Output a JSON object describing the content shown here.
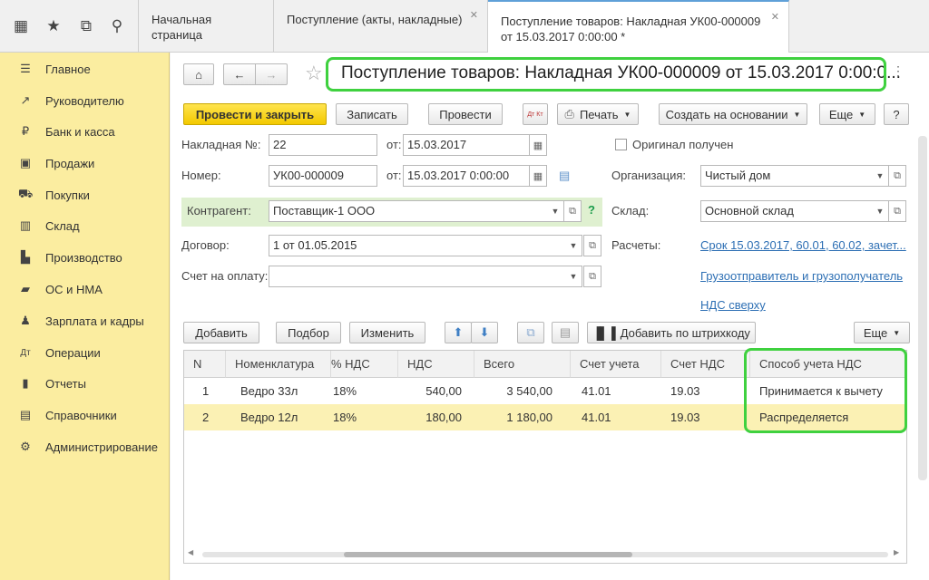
{
  "tabs": [
    {
      "label": "Начальная страница"
    },
    {
      "label": "Поступление (акты, накладные)"
    },
    {
      "label": "Поступление товаров: Накладная УК00-000009 от 15.03.2017 0:00:00 *"
    }
  ],
  "sidebar": {
    "items": [
      {
        "label": "Главное",
        "icon": "menu-icon"
      },
      {
        "label": "Руководителю",
        "icon": "trend-icon"
      },
      {
        "label": "Банк и касса",
        "icon": "ruble-icon"
      },
      {
        "label": "Продажи",
        "icon": "bag-icon"
      },
      {
        "label": "Покупки",
        "icon": "cart-icon"
      },
      {
        "label": "Склад",
        "icon": "warehouse-icon"
      },
      {
        "label": "Производство",
        "icon": "factory-icon"
      },
      {
        "label": "ОС и НМА",
        "icon": "truck-icon"
      },
      {
        "label": "Зарплата и кадры",
        "icon": "people-icon"
      },
      {
        "label": "Операции",
        "icon": "dt-kt-icon"
      },
      {
        "label": "Отчеты",
        "icon": "chart-icon"
      },
      {
        "label": "Справочники",
        "icon": "books-icon"
      },
      {
        "label": "Администрирование",
        "icon": "gear-icon"
      }
    ]
  },
  "doc": {
    "title": "Поступление товаров: Накладная УК00-000009 от 15.03.2017 0:00:0..."
  },
  "toolbar": {
    "post_close": "Провести и закрыть",
    "save": "Записать",
    "post": "Провести",
    "dt_kt": "Дт Кт",
    "print": "Печать",
    "create_based": "Создать на основании",
    "more": "Еще",
    "help": "?"
  },
  "form": {
    "invoice_no_label": "Накладная №:",
    "invoice_no": "22",
    "from_label": "от:",
    "invoice_date": "15.03.2017",
    "original_label": "Оригинал получен",
    "number_label": "Номер:",
    "number": "УК00-000009",
    "number_date": "15.03.2017  0:00:00",
    "org_label": "Организация:",
    "org": "Чистый дом",
    "counterparty_label": "Контрагент:",
    "counterparty": "Поставщик-1 ООО",
    "warehouse_label": "Склад:",
    "warehouse": "Основной склад",
    "contract_label": "Договор:",
    "contract": "1 от 01.05.2015",
    "settlements_label": "Расчеты:",
    "settlements_link": "Срок 15.03.2017, 60.01, 60.02, зачет...",
    "pay_invoice_label": "Счет на оплату:",
    "pay_invoice": "",
    "shipper_link": "Грузоотправитель и грузополучатель",
    "vat_link": "НДС сверху"
  },
  "table_toolbar": {
    "add": "Добавить",
    "pick": "Подбор",
    "change": "Изменить",
    "barcode": "Добавить по штрихкоду",
    "more": "Еще"
  },
  "table": {
    "headers": [
      "N",
      "Номенклатура",
      "% НДС",
      "НДС",
      "Всего",
      "Счет учета",
      "Счет НДС",
      "Способ учета НДС"
    ],
    "rows": [
      [
        "1",
        "Ведро 33л",
        "18%",
        "540,00",
        "3 540,00",
        "41.01",
        "19.03",
        "Принимается к вычету"
      ],
      [
        "2",
        "Ведро 12л",
        "18%",
        "180,00",
        "1 180,00",
        "41.01",
        "19.03",
        "Распределяется"
      ]
    ]
  }
}
